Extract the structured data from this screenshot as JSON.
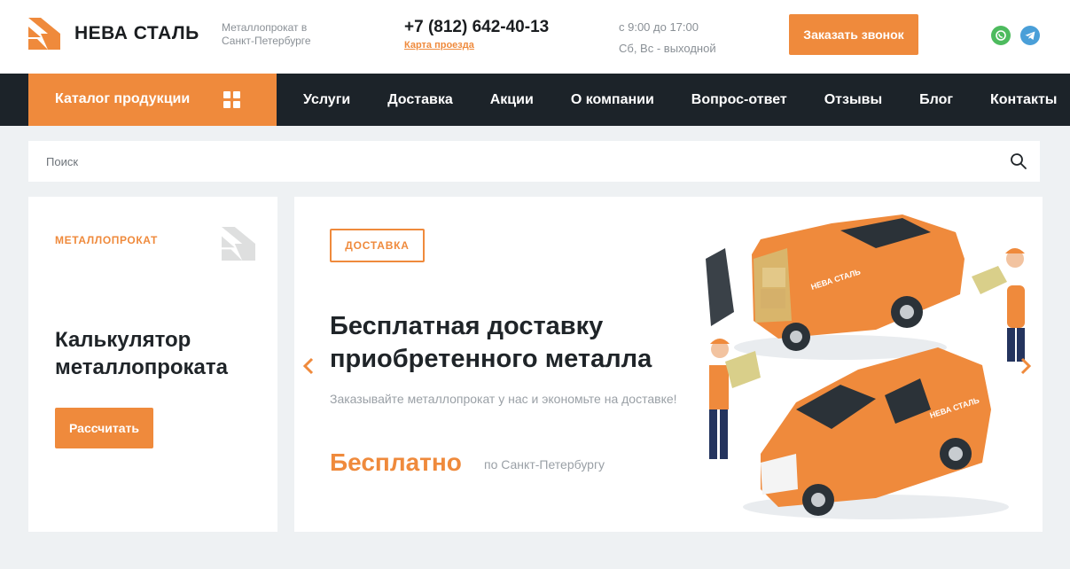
{
  "header": {
    "brand": "НЕВА СТАЛЬ",
    "tagline": "Металлопрокат в Санкт-Петербурге",
    "phone": "+7 (812) 642-40-13",
    "map_link": "Карта проезда",
    "hours_weekday": "с 9:00 до 17:00",
    "hours_weekend": "Сб, Вс - выходной",
    "callback_button": "Заказать звонок",
    "social": [
      {
        "icon": "whatsapp-icon",
        "color": "#4dbb5e"
      },
      {
        "icon": "telegram-icon",
        "color": "#4a9fd8"
      }
    ]
  },
  "nav": {
    "catalog_label": "Каталог продукции",
    "catalog_icon": "grid-icon",
    "items": [
      "Услуги",
      "Доставка",
      "Акции",
      "О компании",
      "Вопрос-ответ",
      "Отзывы",
      "Блог",
      "Контакты"
    ]
  },
  "search": {
    "placeholder": "Поиск",
    "value": "",
    "icon": "search-icon"
  },
  "calculator": {
    "label": "МЕТАЛЛОПРОКАТ",
    "title": "Калькулятор металлопроката",
    "button": "Рассчитать"
  },
  "banner": {
    "badge": "ДОСТАВКА",
    "title": "Бесплатная доставку приобретенного металла",
    "subtitle": "Заказывайте металлопрокат у нас и экономьте на доставке!",
    "price": "Бесплатно",
    "price_note": "по Санкт-Петербургу",
    "van_brand": "НЕВА СТАЛЬ"
  },
  "colors": {
    "accent": "#ef8a3c",
    "nav_bg": "#1c2329",
    "page_bg": "#eef1f3"
  }
}
